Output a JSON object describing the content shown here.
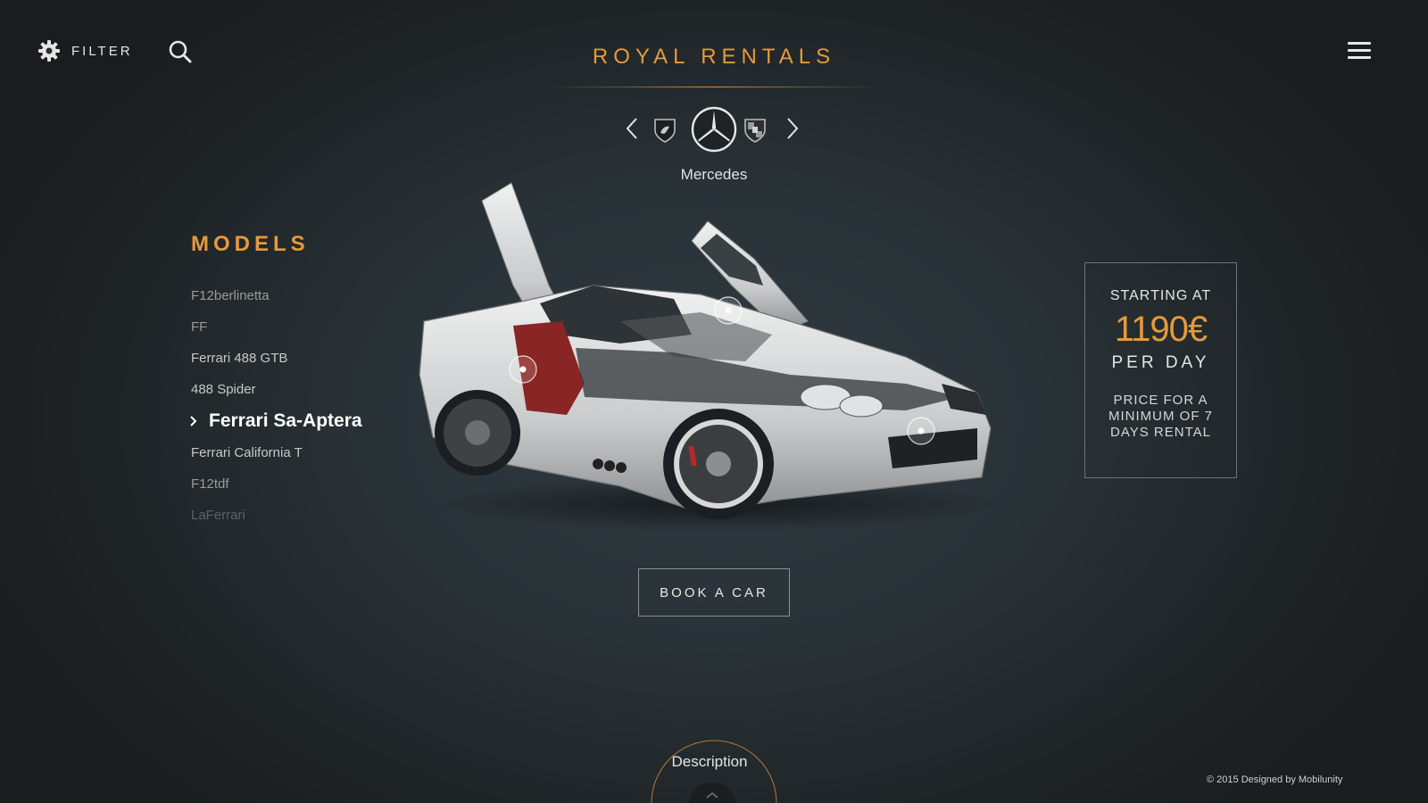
{
  "header": {
    "filter_label": "FILTER",
    "title": "ROYAL RENTALS",
    "filter_icon": "gear-icon",
    "search_icon": "search-icon",
    "menu_icon": "hamburger-menu-icon"
  },
  "brands": {
    "selected": "Mercedes",
    "logos": [
      "lamborghini-logo",
      "mercedes-logo",
      "porsche-logo"
    ],
    "prev_icon": "chevron-left-icon",
    "next_icon": "chevron-right-icon"
  },
  "models": {
    "heading": "MODELS",
    "items": [
      {
        "label": "F12berlinetta",
        "active": false
      },
      {
        "label": "FF",
        "active": false
      },
      {
        "label": "Ferrari 488 GTB",
        "active": false
      },
      {
        "label": "488 Spider",
        "active": false
      },
      {
        "label": "Ferrari Sa-Aptera",
        "active": true
      },
      {
        "label": "Ferrari California T",
        "active": false
      },
      {
        "label": "F12tdf",
        "active": false
      },
      {
        "label": "LaFerrari",
        "active": false
      }
    ]
  },
  "price": {
    "starting": "STARTING AT",
    "amount": "1190€",
    "per": "PER DAY",
    "note": "PRICE FOR A MINIMUM OF 7 DAYS RENTAL"
  },
  "book_label": "BOOK A CAR",
  "description_label": "Description",
  "footer": "© 2015 Designed by  Mobilunity",
  "colors": {
    "accent": "#e59a3c",
    "background": "#283136"
  }
}
